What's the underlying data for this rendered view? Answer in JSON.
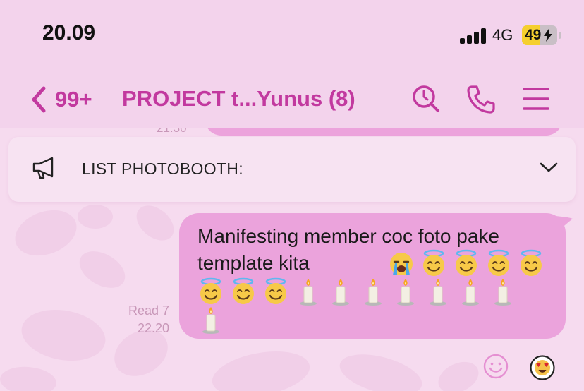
{
  "status_bar": {
    "time": "20.09",
    "network": "4G",
    "battery": "49",
    "battery_level": 0.49,
    "charging": true
  },
  "header": {
    "back_count": "99+",
    "title": "PROJECT t...Yunus (8)",
    "accent_color": "#c2399f",
    "actions": [
      "search-icon",
      "phone-icon",
      "menu-icon"
    ]
  },
  "previous_message": {
    "time": "21.30"
  },
  "pinned": {
    "icon": "megaphone-icon",
    "text": "LIST PHOTOBOOTH:"
  },
  "message": {
    "text": "Manifesting member coc foto pake template kita",
    "emoji_line1": [
      "loudly-crying-face",
      "smiling-face-with-halo",
      "smiling-face-with-halo",
      "smiling-face-with-halo",
      "smiling-face-with-halo"
    ],
    "emoji_line2": [
      "smiling-face-with-halo",
      "smiling-face-with-halo",
      "smiling-face-with-halo",
      "candle",
      "candle",
      "candle",
      "candle",
      "candle",
      "candle",
      "candle"
    ],
    "emoji_line3": [
      "candle"
    ],
    "read_status": "Read 7",
    "time": "22.20",
    "bubble_color": "#eba3dc"
  },
  "reactions": {
    "add_icon": "smiley-add-icon",
    "existing": "heart-eyes-face"
  }
}
